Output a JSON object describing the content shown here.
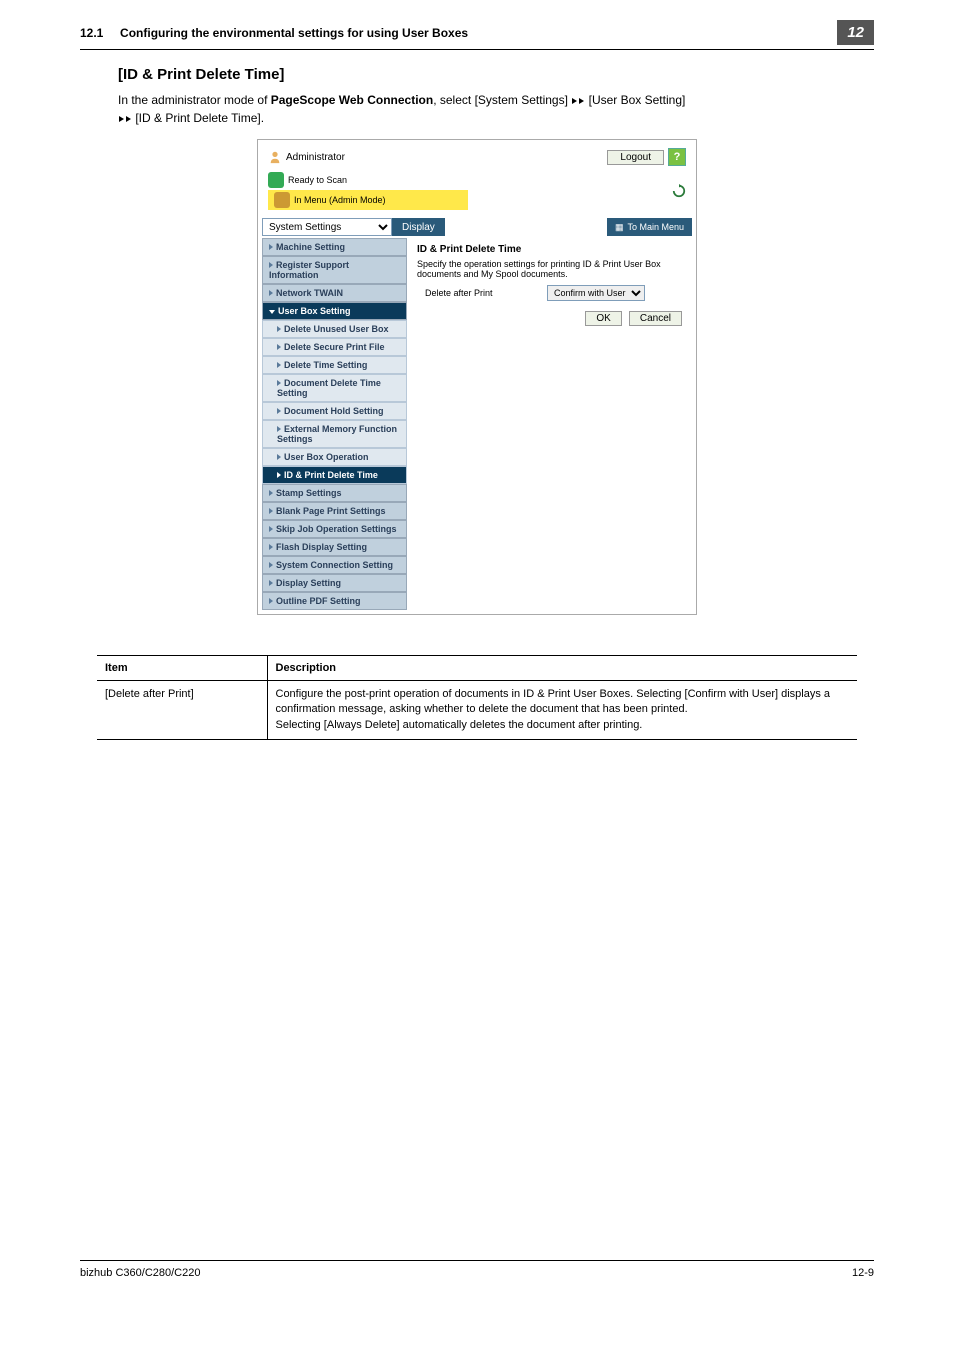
{
  "header": {
    "section_no": "12.1",
    "section_title": "Configuring the environmental settings for using User Boxes",
    "badge": "12"
  },
  "section": {
    "title": "[ID & Print Delete Time]",
    "desc_prefix": "In the administrator mode of ",
    "desc_bold": "PageScope Web Connection",
    "desc_mid1": ", select [System Settings] ",
    "desc_mid2": " [User Box Setting] ",
    "desc_mid3": " [ID & Print Delete Time]."
  },
  "topbar": {
    "role": "Administrator",
    "logout": "Logout",
    "help": "?"
  },
  "status": {
    "ready": "Ready to Scan",
    "warn": "In Menu (Admin Mode)"
  },
  "nav": {
    "select_value": "System Settings",
    "display": "Display",
    "main_menu": "To Main Menu"
  },
  "sidebar": {
    "items": [
      {
        "label": "Machine Setting",
        "type": "item"
      },
      {
        "label": "Register Support Information",
        "type": "item"
      },
      {
        "label": "Network TWAIN",
        "type": "item"
      },
      {
        "label": "User Box Setting",
        "type": "active-parent"
      },
      {
        "label": "Delete Unused User Box",
        "type": "sub"
      },
      {
        "label": "Delete Secure Print File",
        "type": "sub"
      },
      {
        "label": "Delete Time Setting",
        "type": "sub"
      },
      {
        "label": "Document Delete Time Setting",
        "type": "sub"
      },
      {
        "label": "Document Hold Setting",
        "type": "sub"
      },
      {
        "label": "External Memory Function Settings",
        "type": "sub"
      },
      {
        "label": "User Box Operation",
        "type": "sub"
      },
      {
        "label": "ID & Print Delete Time",
        "type": "sub-active"
      },
      {
        "label": "Stamp Settings",
        "type": "item"
      },
      {
        "label": "Blank Page Print Settings",
        "type": "item"
      },
      {
        "label": "Skip Job Operation Settings",
        "type": "item"
      },
      {
        "label": "Flash Display Setting",
        "type": "item"
      },
      {
        "label": "System Connection Setting",
        "type": "item"
      },
      {
        "label": "Display Setting",
        "type": "item"
      },
      {
        "label": "Outline PDF Setting",
        "type": "item"
      }
    ]
  },
  "panel": {
    "title": "ID & Print Delete Time",
    "desc": "Specify the operation settings for printing ID & Print User Box documents and My Spool documents.",
    "row_label": "Delete after Print",
    "row_value": "Confirm with User",
    "ok": "OK",
    "cancel": "Cancel"
  },
  "table": {
    "h1": "Item",
    "h2": "Description",
    "r1c1": "[Delete after Print]",
    "r1c2": "Configure the post-print operation of documents in ID & Print User Boxes. Selecting [Confirm with User] displays a confirmation message, asking whether to delete the document that has been printed.\nSelecting [Always Delete] automatically deletes the document after printing."
  },
  "footer": {
    "model": "bizhub C360/C280/C220",
    "page": "12-9"
  }
}
